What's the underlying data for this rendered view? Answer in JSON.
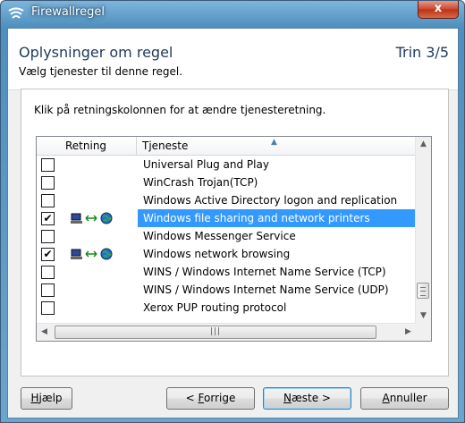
{
  "window": {
    "title": "Firewallregel",
    "close_label": "x",
    "icon": "firewall-app-icon"
  },
  "header": {
    "title": "Oplysninger om regel",
    "step": "Trin 3/5",
    "subtitle": "Vælg tjenester til denne regel."
  },
  "panel": {
    "instruction": "Klik på retningskolonnen for at ændre tjenesteretning."
  },
  "list": {
    "columns": {
      "direction": "Retning",
      "service": "Tjeneste"
    },
    "rows": [
      {
        "checked": false,
        "direction": "",
        "service": "Universal Plug and Play",
        "selected": false
      },
      {
        "checked": false,
        "direction": "",
        "service": "WinCrash Trojan(TCP)",
        "selected": false
      },
      {
        "checked": false,
        "direction": "",
        "service": "Windows Active Directory logon and replication",
        "selected": false
      },
      {
        "checked": true,
        "direction": "bidirectional",
        "service": "Windows file sharing and network printers",
        "selected": true
      },
      {
        "checked": false,
        "direction": "",
        "service": "Windows Messenger Service",
        "selected": false
      },
      {
        "checked": true,
        "direction": "bidirectional",
        "service": "Windows network browsing",
        "selected": false
      },
      {
        "checked": false,
        "direction": "",
        "service": "WINS / Windows Internet Name Service (TCP)",
        "selected": false
      },
      {
        "checked": false,
        "direction": "",
        "service": "WINS / Windows Internet Name Service (UDP)",
        "selected": false
      },
      {
        "checked": false,
        "direction": "",
        "service": "Xerox PUP routing protocol",
        "selected": false
      }
    ],
    "check_mark": "✔"
  },
  "buttons": {
    "help_mnemonic": "H",
    "help_rest": "jælp",
    "back_prefix": "< ",
    "back_mnemonic": "F",
    "back_rest": "orrige",
    "next_mnemonic": "N",
    "next_rest": "æste >",
    "cancel_mnemonic": "A",
    "cancel_rest": "nnuller"
  },
  "colors": {
    "selection": "#3399ff",
    "title_text": "#1e395b",
    "frame": "#4d8fbf"
  }
}
